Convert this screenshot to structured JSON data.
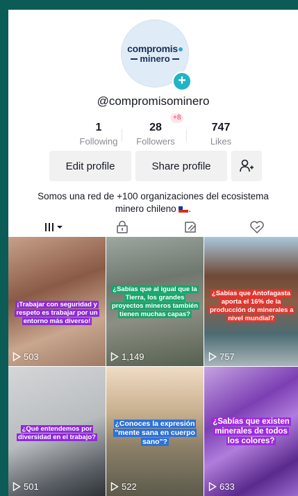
{
  "profile": {
    "logo_top": "compromis",
    "logo_bottom": "minero",
    "username": "@compromisominero",
    "bio": "Somos una red de +100 organizaciones del ecosistema minero chileno"
  },
  "stats": {
    "following": {
      "value": "1",
      "label": "Following"
    },
    "followers": {
      "value": "28",
      "label": "Followers",
      "delta": "+8"
    },
    "likes": {
      "value": "747",
      "label": "Likes"
    }
  },
  "buttons": {
    "edit": "Edit profile",
    "share": "Share profile"
  },
  "tabs": [
    "videos",
    "private",
    "reposts",
    "liked"
  ],
  "videos": [
    {
      "caption": "¡Trabajar con seguridad y respeto es trabajar por un entorno más diverso!",
      "views": "503"
    },
    {
      "caption": "¿Sabías que al igual que la Tierra, los grandes proyectos mineros también tienen muchas capas?",
      "views": "1,149"
    },
    {
      "caption": "¿Sabías que Antofagasta aporta el 16% de la producción de minerales a nivel mundial?",
      "views": "757"
    },
    {
      "caption": "¿Qué entendemos por diversidad en el trabajo?",
      "views": "501"
    },
    {
      "caption": "¿Conoces la expresión \"mente sana en cuerpo sano\"?",
      "views": "522"
    },
    {
      "caption": "¿Sabías que existen minerales de todos los colores?",
      "views": "633"
    }
  ],
  "colors": {
    "accent": "#20b4c6",
    "delta": "#fe2c55",
    "background": "#0b5b57"
  }
}
